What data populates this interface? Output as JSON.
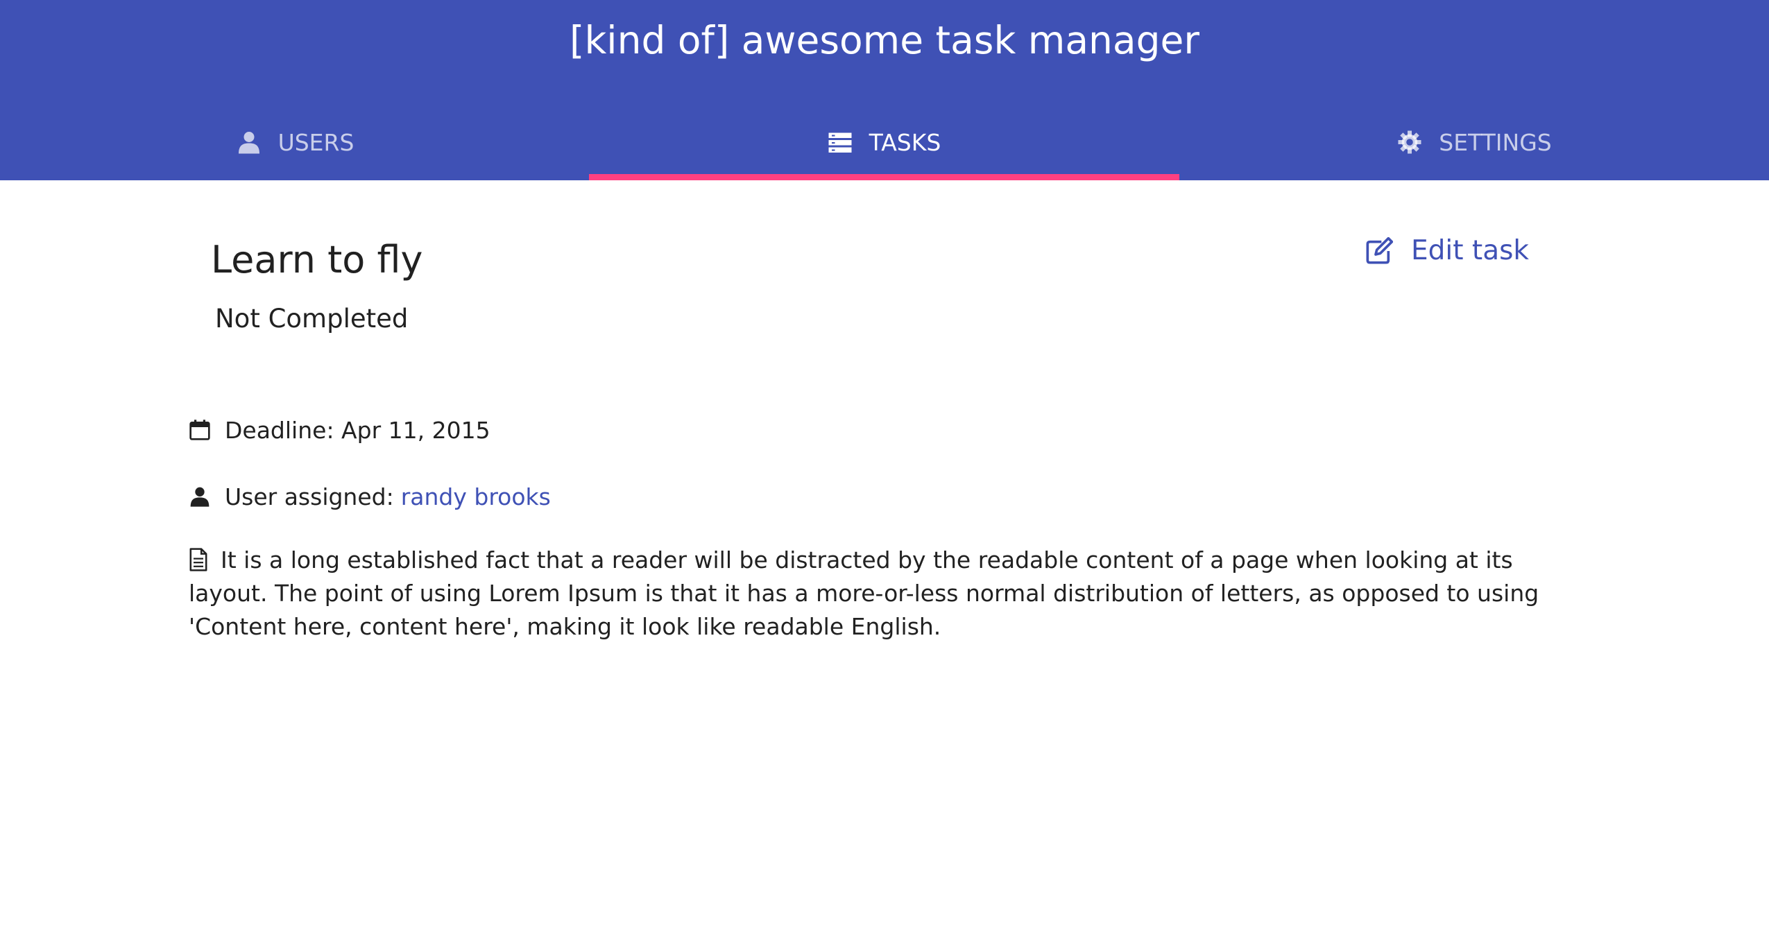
{
  "header": {
    "title": "[kind of] awesome task manager",
    "bg_color": "#3f51b5",
    "indicator_color": "#ff4081"
  },
  "tabs": [
    {
      "label": "USERS",
      "icon": "user-icon",
      "active": false
    },
    {
      "label": "TASKS",
      "icon": "list-icon",
      "active": true
    },
    {
      "label": "SETTINGS",
      "icon": "gear-icon",
      "active": false
    }
  ],
  "task": {
    "title": "Learn to fly",
    "status": "Not Completed",
    "edit_label": "Edit task",
    "deadline_label": "Deadline: Apr 11, 2015",
    "user_label": "User assigned:",
    "user_name": "randy brooks",
    "description": "It is a long established fact that a reader will be distracted by the readable content of a page when looking at its layout. The point of using Lorem Ipsum is that it has a more-or-less normal distribution of letters, as opposed to using 'Content here, content here', making it look like readable English."
  },
  "icons": {
    "edit": "edit-icon",
    "deadline": "calendar-icon",
    "user": "user-icon",
    "description": "document-icon"
  }
}
